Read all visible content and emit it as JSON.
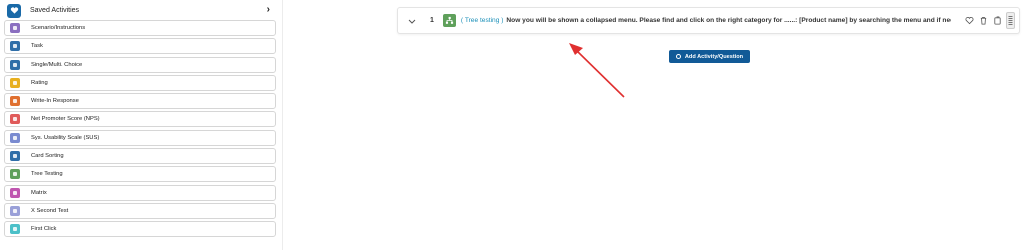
{
  "sidebar": {
    "saved_label": "Saved Activities",
    "items": [
      {
        "label": "Scenario/Instructions",
        "color": "#8b6fc0",
        "icon": "document-icon"
      },
      {
        "label": "Task",
        "color": "#2f6ea8",
        "icon": "task-icon"
      },
      {
        "label": "Single/Multi. Choice",
        "color": "#2f6ea8",
        "icon": "checkbox-icon"
      },
      {
        "label": "Rating",
        "color": "#e8b020",
        "icon": "star-icon"
      },
      {
        "label": "Write-In Response",
        "color": "#e07030",
        "icon": "text-icon"
      },
      {
        "label": "Net Promoter Score (NPS)",
        "color": "#e05a5a",
        "icon": "megaphone-icon"
      },
      {
        "label": "Sys. Usability Scale (SUS)",
        "color": "#7a8bd0",
        "icon": "scale-icon"
      },
      {
        "label": "Card Sorting",
        "color": "#2f6ea8",
        "icon": "cards-icon"
      },
      {
        "label": "Tree Testing",
        "color": "#5fa05b",
        "icon": "tree-icon"
      },
      {
        "label": "Matrix",
        "color": "#c056b0",
        "icon": "matrix-icon"
      },
      {
        "label": "X Second Test",
        "color": "#9aa0d8",
        "icon": "timer-icon"
      },
      {
        "label": "First Click",
        "color": "#4cc0c8",
        "icon": "cursor-icon"
      }
    ]
  },
  "activity": {
    "number": "1",
    "tag": "( Tree testing )",
    "question": "Now you will be shown a collapsed menu. Please find and click on the right category for ......: [Product name] by searching the menu and if neces..."
  },
  "add_button_label": "Add Activity/Question",
  "colors": {
    "primary": "#115a97",
    "annotation_arrow": "#e03030"
  }
}
